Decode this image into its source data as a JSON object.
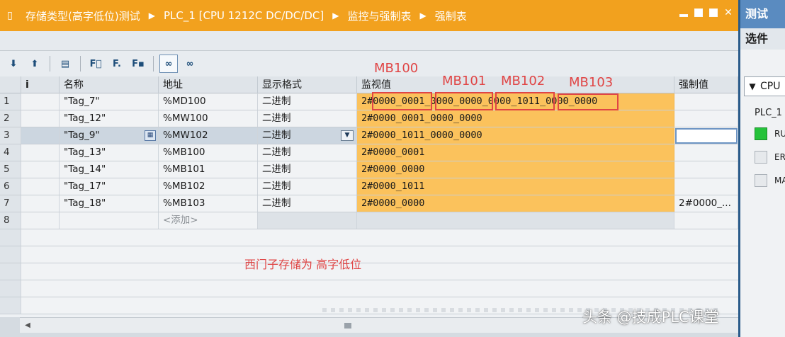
{
  "window": {
    "breadcrumbs": [
      "存储类型(高字低位)测试",
      "PLC_1 [CPU 1212C DC/DC/DC]",
      "监控与强制表",
      "强制表"
    ]
  },
  "toolbar": {
    "buttons": [
      {
        "name": "monitor-all-icon",
        "glyph": "⬇"
      },
      {
        "name": "monitor-once-icon",
        "glyph": "⬆"
      },
      {
        "name": "show-force-icon",
        "glyph": "🗎"
      },
      {
        "name": "force-all-icon",
        "glyph": "F"
      },
      {
        "name": "force-icon",
        "glyph": "F"
      },
      {
        "name": "stop-force-icon",
        "glyph": "F"
      },
      {
        "name": "monitor-glasses-icon",
        "glyph": "👓"
      },
      {
        "name": "monitor-glasses-once-icon",
        "glyph": "👓"
      }
    ]
  },
  "table": {
    "headers": {
      "info": "i",
      "name": "名称",
      "address": "地址",
      "format": "显示格式",
      "monitor": "监视值",
      "force": "强制值"
    },
    "rows": [
      {
        "num": "1",
        "name": "\"Tag_7\"",
        "address": "%MD100",
        "format": "二进制",
        "monitor": "2#0000_0001_0000_0000_0000_1011_0000_0000",
        "force": ""
      },
      {
        "num": "2",
        "name": "\"Tag_12\"",
        "address": "%MW100",
        "format": "二进制",
        "monitor": "2#0000_0001_0000_0000",
        "force": ""
      },
      {
        "num": "3",
        "name": "\"Tag_9\"",
        "address": "%MW102",
        "format": "二进制",
        "monitor": "2#0000_1011_0000_0000",
        "force": ""
      },
      {
        "num": "4",
        "name": "\"Tag_13\"",
        "address": "%MB100",
        "format": "二进制",
        "monitor": "2#0000_0001",
        "force": ""
      },
      {
        "num": "5",
        "name": "\"Tag_14\"",
        "address": "%MB101",
        "format": "二进制",
        "monitor": "2#0000_0000",
        "force": ""
      },
      {
        "num": "6",
        "name": "\"Tag_17\"",
        "address": "%MB102",
        "format": "二进制",
        "monitor": "2#0000_1011",
        "force": ""
      },
      {
        "num": "7",
        "name": "\"Tag_18\"",
        "address": "%MB103",
        "format": "二进制",
        "monitor": "2#0000_0000",
        "force": "2#0000_..."
      }
    ],
    "add_row": {
      "num": "8",
      "placeholder": "<添加>"
    }
  },
  "annotations": {
    "byte_labels": [
      "MB100",
      "MB101",
      "MB102",
      "MB103"
    ],
    "note": "西门子存储为 高字低位",
    "color": "#e04545"
  },
  "right_pane": {
    "tab": "测试",
    "options_label": "选件",
    "cpu_select": "CPU",
    "plc_name": "PLC_1",
    "leds": [
      {
        "label": "RUN",
        "state": "green"
      },
      {
        "label": "ERROR",
        "state": "off"
      },
      {
        "label": "MAINT",
        "state": "off"
      }
    ]
  },
  "watermark": "头条 @技成PLC课堂",
  "colors": {
    "titlebar": "#f2a11e",
    "monitor_cell": "#fbc25c",
    "accent": "#5a8bc0"
  }
}
